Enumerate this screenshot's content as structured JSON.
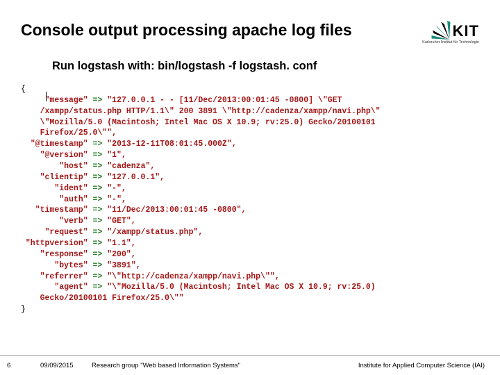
{
  "header": {
    "title": "Console output processing apache log files",
    "logo_text": "KIT",
    "logo_sub": "Karlsruher Institut für Technologie"
  },
  "subtitle": "Run logstash with: bin/logstash -f logstash. conf",
  "code": {
    "open": "{",
    "lines": [
      {
        "key": "\"message\"",
        "val": "\"127.0.0.1 - - [11/Dec/2013:00:01:45 -0800] \\\"GET",
        "cont": [
          "/xampp/status.php HTTP/1.1\\\" 200 3891 \\\"http://cadenza/xampp/navi.php\\\"",
          "\\\"Mozilla/5.0 (Macintosh; Intel Mac OS X 10.9; rv:25.0) Gecko/20100101",
          "Firefox/25.0\\\"\","
        ]
      },
      {
        "key": "\"@timestamp\"",
        "val": "\"2013-12-11T08:01:45.000Z\","
      },
      {
        "key": "\"@version\"",
        "val": "\"1\","
      },
      {
        "key": "\"host\"",
        "val": "\"cadenza\","
      },
      {
        "key": "\"clientip\"",
        "val": "\"127.0.0.1\","
      },
      {
        "key": "\"ident\"",
        "val": "\"-\","
      },
      {
        "key": "\"auth\"",
        "val": "\"-\","
      },
      {
        "key": "\"timestamp\"",
        "val": "\"11/Dec/2013:00:01:45 -0800\","
      },
      {
        "key": "\"verb\"",
        "val": "\"GET\","
      },
      {
        "key": "\"request\"",
        "val": "\"/xampp/status.php\","
      },
      {
        "key": "\"httpversion\"",
        "val": "\"1.1\","
      },
      {
        "key": "\"response\"",
        "val": "\"200\","
      },
      {
        "key": "\"bytes\"",
        "val": "\"3891\","
      },
      {
        "key": "\"referrer\"",
        "val": "\"\\\"http://cadenza/xampp/navi.php\\\"\","
      },
      {
        "key": "\"agent\"",
        "val": "\"\\\"Mozilla/5.0 (Macintosh; Intel Mac OS X 10.9; rv:25.0)",
        "cont": [
          "Gecko/20100101 Firefox/25.0\\\"\""
        ]
      }
    ],
    "close": "}",
    "arrow": "=>"
  },
  "footer": {
    "page": "6",
    "date": "09/09/2015",
    "group": "Research group \"Web based Information Systems\"",
    "institute": "Institute for Applied Computer Science (IAI)"
  }
}
